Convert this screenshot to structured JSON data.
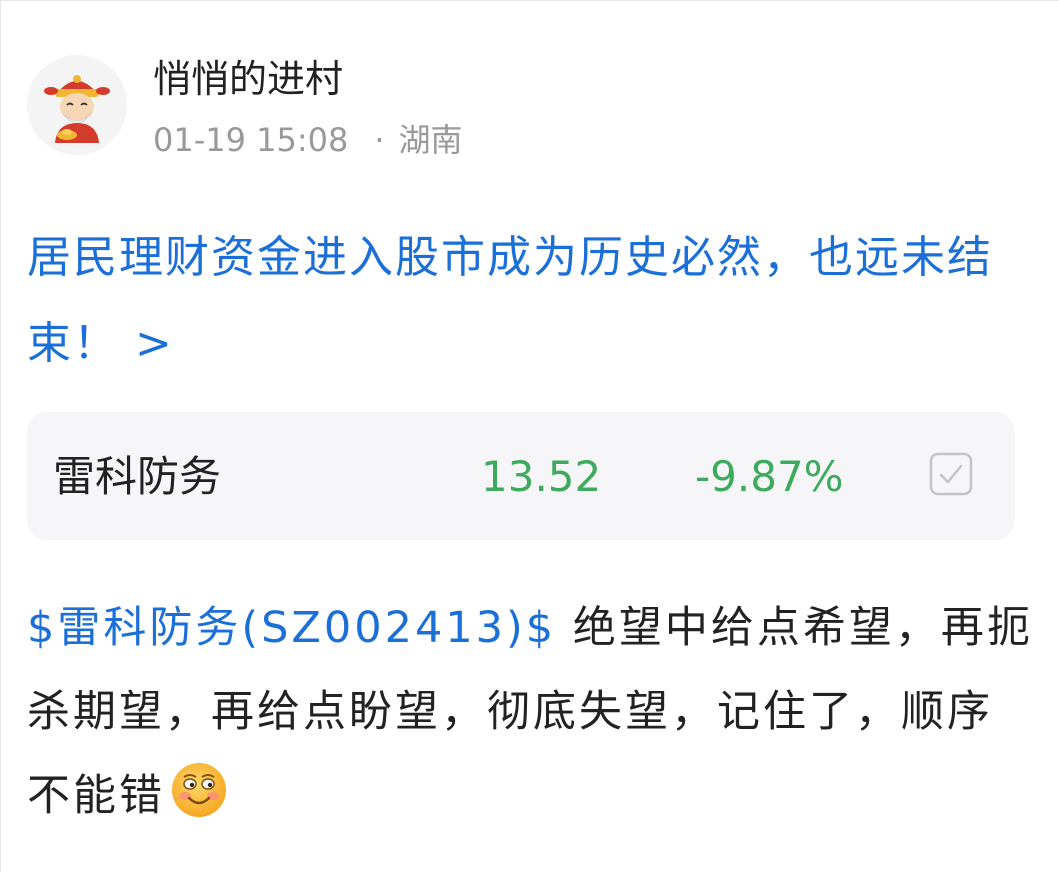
{
  "author": {
    "avatar_icon": "caishen-avatar-icon",
    "username": "悄悄的进村",
    "timestamp": "01-19 15:08",
    "separator": "·",
    "location": "湖南"
  },
  "post": {
    "title": "居民理财资金进入股市成为历史必然，也远未结束！ >",
    "stock_card": {
      "name": "雷科防务",
      "price": "13.52",
      "change": "-9.87%",
      "action_icon": "checkbox-icon",
      "change_color": "#3daa5d"
    },
    "body": {
      "stock_link": "$雷科防务(SZ002413)$",
      "text": "  绝望中给点希望，再扼杀期望，再给点盼望，彻底失望，记住了，顺序不能错",
      "emoji_icon": "grinning-face-emoji-icon"
    }
  },
  "colors": {
    "link": "#1a6fd8",
    "down_green": "#3daa5d",
    "meta_gray": "#999999",
    "card_bg": "#f6f6f8"
  }
}
